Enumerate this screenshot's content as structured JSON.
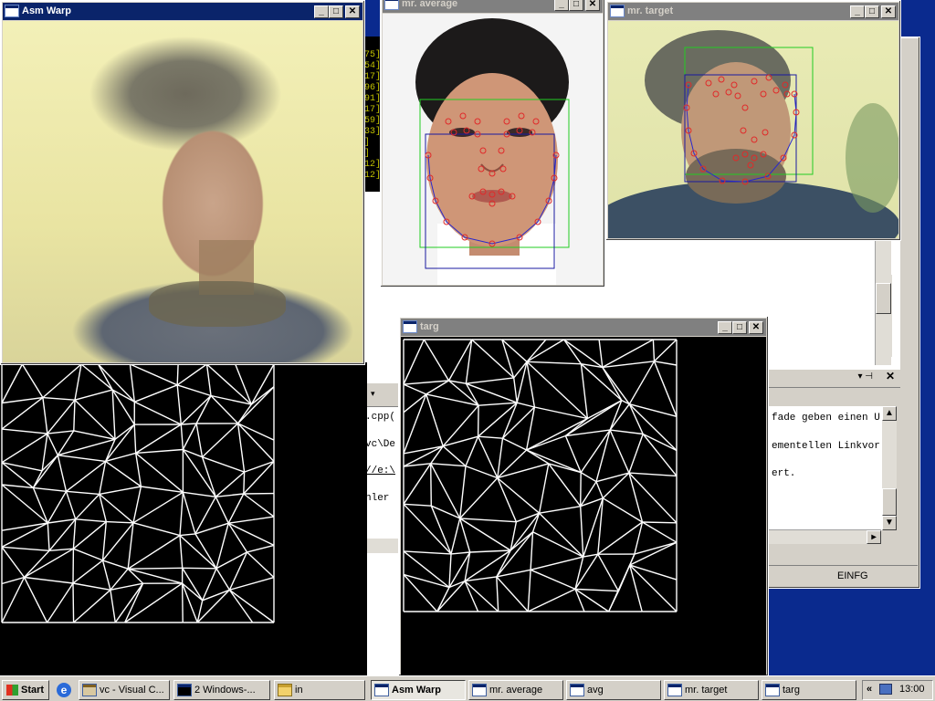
{
  "windows": {
    "asm_warp": {
      "title": "Asm Warp"
    },
    "mr_average": {
      "title": "mr. average"
    },
    "mr_target": {
      "title": "mr. target"
    },
    "targ": {
      "title": "targ"
    }
  },
  "console_lines": [
    "75]",
    "54]",
    "17]",
    "96]",
    "91]",
    "17]",
    "59]",
    "33]",
    "]",
    "]",
    "12]",
    "12]"
  ],
  "vs_output": {
    "left_lines": [
      ".cpp(",
      "vc\\De",
      "//e:\\",
      "hler"
    ],
    "right_lines": [
      "fade geben einen U",
      "ementellen Linkvor",
      "ert."
    ],
    "status": "EINFG"
  },
  "taskbar": {
    "start": "Start",
    "tasks": [
      "vc - Visual C...",
      "2 Windows-...",
      "in",
      "Asm Warp",
      "mr. average",
      "avg",
      "mr. target",
      "targ"
    ],
    "clock": "13:00"
  },
  "colors": {
    "titlebar_active": "#0a246a",
    "titlebar_inactive": "#808080",
    "desktop": "#0a2a8e",
    "bbox_green": "#22cc22",
    "bbox_blue": "#1a1aa0",
    "landmark_red": "#e02a2a"
  }
}
